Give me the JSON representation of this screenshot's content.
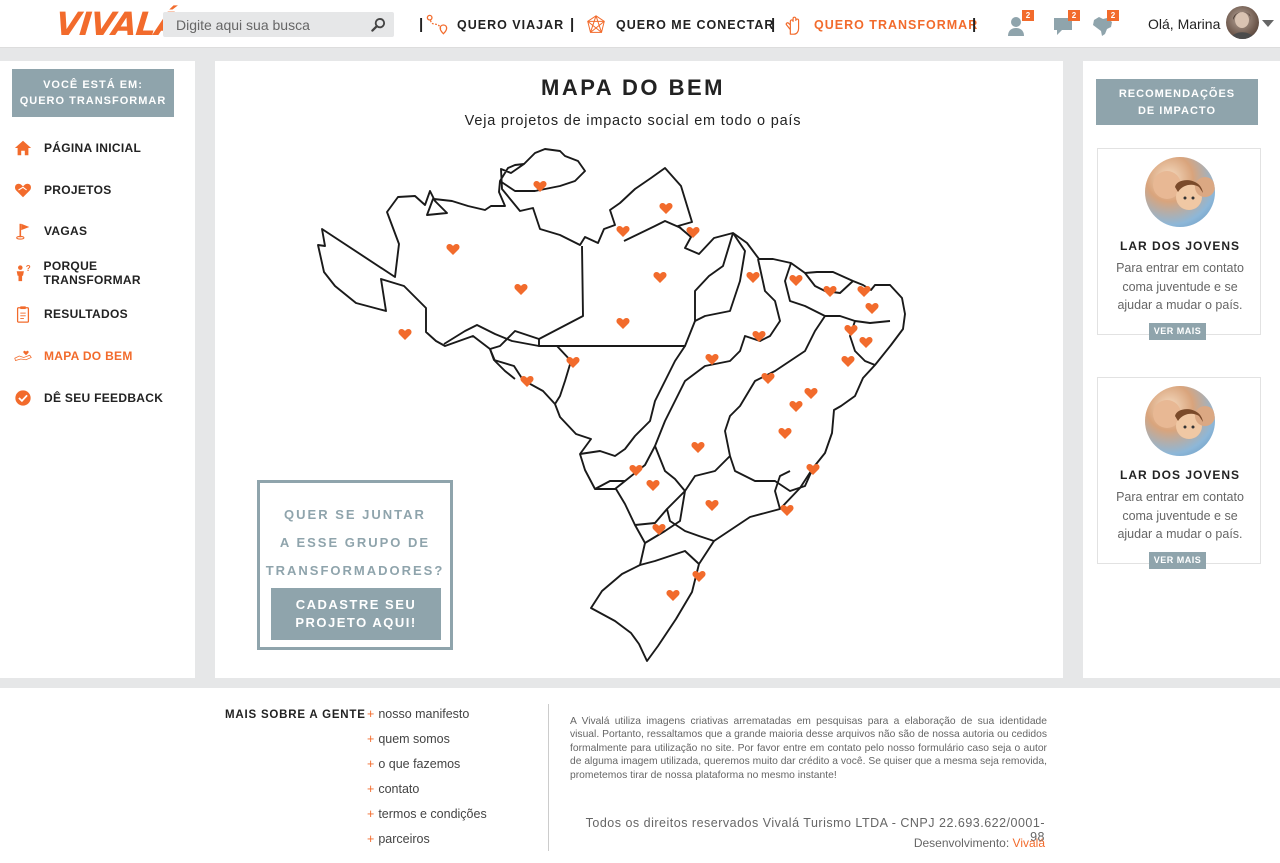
{
  "brand": {
    "name": "VIVALÁ",
    "accent_color": "#f26b2c",
    "muted_color": "#8fa4ac"
  },
  "header": {
    "search_placeholder": "Digite aqui sua busca",
    "nav": [
      {
        "label": "QUERO VIAJAR",
        "icon": "route-icon"
      },
      {
        "label": "QUERO ME CONECTAR",
        "icon": "network-icon"
      },
      {
        "label": "QUERO TRANSFORMAR",
        "icon": "hand-icon",
        "active": true
      }
    ],
    "separator": "|",
    "notifications": [
      {
        "icon": "user-icon",
        "count": "2"
      },
      {
        "icon": "chat-icon",
        "count": "2"
      },
      {
        "icon": "brazil-map-icon",
        "count": "2"
      }
    ],
    "greeting": "Olá, Marina"
  },
  "sidebar": {
    "location_title": "VOCÊ ESTÁ EM:",
    "location_value": "QUERO TRANSFORMAR",
    "items": [
      {
        "label": "PÁGINA INICIAL",
        "icon": "home-icon"
      },
      {
        "label": "PROJETOS",
        "icon": "heart-hands-icon"
      },
      {
        "label": "VAGAS",
        "icon": "flag-icon"
      },
      {
        "label": "PORQUE TRANSFORMAR",
        "icon": "person-question-icon"
      },
      {
        "label": "RESULTADOS",
        "icon": "clipboard-icon"
      },
      {
        "label": "MAPA DO BEM",
        "icon": "map-heart-icon",
        "active": true
      },
      {
        "label": "DÊ SEU FEEDBACK",
        "icon": "check-circle-icon"
      }
    ]
  },
  "main": {
    "title": "MAPA DO BEM",
    "subtitle": "Veja projetos de impacto social em todo o país",
    "cta_question_1": "QUER SE JUNTAR",
    "cta_question_2": "A ESSE GRUPO DE",
    "cta_question_3": "TRANSFORMADORES?",
    "cta_button_1": "CADASTRE SEU",
    "cta_button_2": "PROJETO AQUI!"
  },
  "recommendations": {
    "title_1": "RECOMENDAÇÕES",
    "title_2": "DE IMPACTO",
    "cards": [
      {
        "name": "LAR DOS JOVENS",
        "description": "Para entrar em contato coma juventude e se ajudar a mudar o país.",
        "button": "VER MAIS"
      },
      {
        "name": "LAR DOS JOVENS",
        "description": "Para entrar em contato coma juventude e se ajudar a mudar o país.",
        "button": "VER MAIS"
      }
    ]
  },
  "footer": {
    "title": "MAIS SOBRE A GENTE",
    "plus": "+",
    "links": [
      "nosso manifesto",
      "quem somos",
      "o que fazemos",
      "contato",
      "termos e condições",
      "parceiros"
    ],
    "disclaimer": "A Vivalá utiliza imagens criativas arrematadas em pesquisas para a elaboração de sua identidade visual. Portanto, ressaltamos que a grande maioria desse arquivos não são de nossa autoria ou cedidos formalmente para utilização no site. Por favor entre em contato pelo nosso formulário caso seja o autor de alguma imagem utilizada, queremos muito dar crédito a você. Se quiser que a mesma seja removida, prometemos tirar de nossa plataforma no mesmo instante!",
    "rights": "Todos os direitos reservados Vivalá Turismo LTDA   -  CNPJ 22.693.622/0001-98",
    "dev_label": "Desenvolvimento: ",
    "dev_name": "Vivalá"
  }
}
